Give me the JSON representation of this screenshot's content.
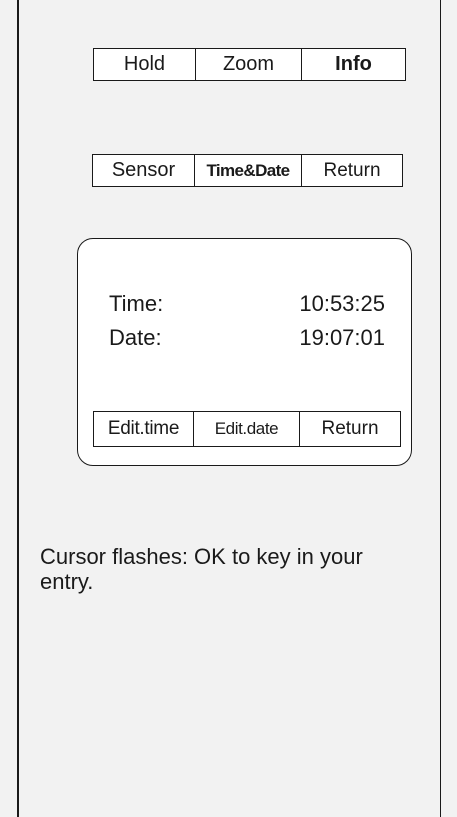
{
  "top_menu": {
    "items": [
      {
        "label": "Hold",
        "bold": false
      },
      {
        "label": "Zoom",
        "bold": false
      },
      {
        "label": "Info",
        "bold": true
      }
    ]
  },
  "info_menu": {
    "items": [
      {
        "label": "Sensor",
        "bold": false
      },
      {
        "label": "Time&Date",
        "bold": true
      },
      {
        "label": "Return",
        "bold": false
      }
    ]
  },
  "time_date_panel": {
    "time_label": "Time:",
    "time_value": "10:53:25",
    "date_label": "Date:",
    "date_value": "19:07:01",
    "actions": [
      {
        "label": "Edit.time"
      },
      {
        "label": "Edit.date"
      },
      {
        "label": "Return"
      }
    ]
  },
  "instruction": {
    "text": "Cursor flashes: OK to key in your entry."
  }
}
